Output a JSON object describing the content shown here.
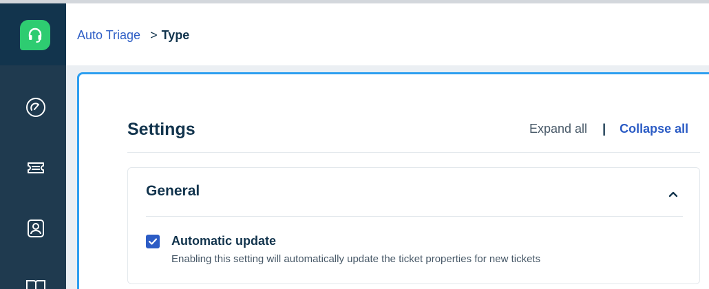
{
  "breadcrumb": {
    "parent": "Auto Triage",
    "separator": ">",
    "current": "Type"
  },
  "sidebar": {
    "logo_icon": "headset-icon",
    "items": [
      {
        "icon": "dashboard-icon"
      },
      {
        "icon": "ticket-icon"
      },
      {
        "icon": "contacts-icon"
      },
      {
        "icon": "book-icon"
      }
    ]
  },
  "settings": {
    "title": "Settings",
    "expand_all": "Expand all",
    "separator": "|",
    "collapse_all": "Collapse all"
  },
  "general": {
    "title": "General",
    "expanded": true,
    "option": {
      "checked": true,
      "label": "Automatic update",
      "description": "Enabling this setting will automatically update the ticket properties for new tickets"
    }
  },
  "colors": {
    "accent": "#2c5cc5",
    "brand_green": "#2ecc71",
    "sidebar": "#1f3a4f",
    "panel_border": "#2c9ef0"
  }
}
